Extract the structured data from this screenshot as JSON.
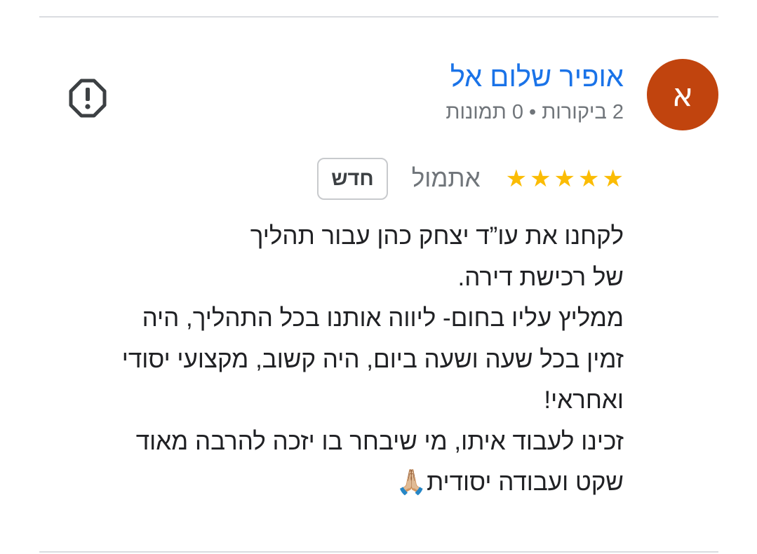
{
  "reviewer": {
    "name": "אופיר שלום אל",
    "initial": "א",
    "avatar_color": "#c1440e",
    "meta": "2 ביקורות • 0 תמונות"
  },
  "review": {
    "rating": 5,
    "max_rating": 5,
    "star_color": "#fbbc04",
    "date": "אתמול",
    "badge": "חדש",
    "lines": [
      "לקחנו את עו”ד יצחק כהן עבור תהליך",
      "של רכישת דירה.",
      "ממליץ עליו בחום- ליווה אותנו בכל התהליך, היה",
      "זמין בכל שעה ושעה ביום, היה קשוב, מקצועי יסודי",
      "ואחראי!",
      "זכינו לעבוד איתו, מי שיבחר בו יזכה להרבה מאוד",
      "שקט ועבודה יסודית🙏🏼"
    ]
  },
  "icons": {
    "report": "report-flag-icon",
    "star": "star-icon"
  },
  "colors": {
    "link": "#1a73e8",
    "secondary_text": "#70757a",
    "body_text": "#202124",
    "divider": "#dadce0"
  }
}
